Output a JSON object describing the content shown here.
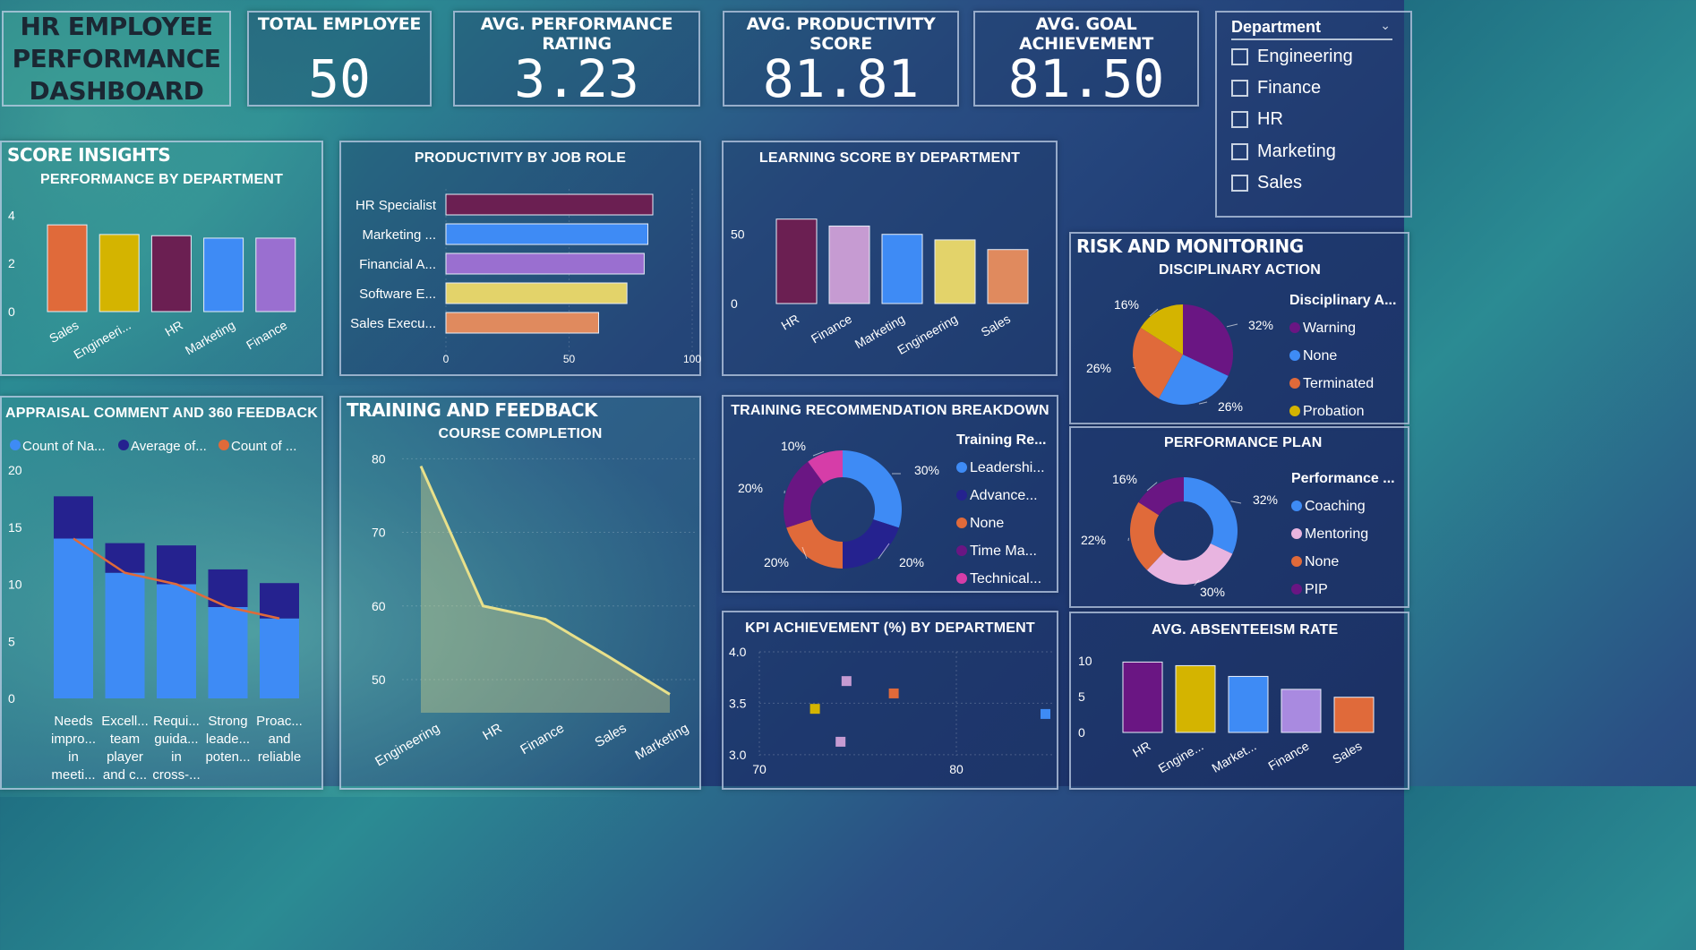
{
  "dashboard": {
    "title_lines": [
      "HR EMPLOYEE",
      "PERFORMANCE",
      "DASHBOARD"
    ]
  },
  "kpis": [
    {
      "label": "TOTAL EMPLOYEE",
      "value": "50"
    },
    {
      "label": "AVG. PERFORMANCE RATING",
      "value": "3.23"
    },
    {
      "label": "AVG. PRODUCTIVITY SCORE",
      "value": "81.81"
    },
    {
      "label": "AVG. GOAL ACHIEVEMENT",
      "value": "81.50"
    }
  ],
  "slicer": {
    "header": "Department",
    "items": [
      "Engineering",
      "Finance",
      "HR",
      "Marketing",
      "Sales"
    ]
  },
  "sections": {
    "score_insights": "SCORE INSIGHTS",
    "training_feedback": "TRAINING AND FEEDBACK",
    "risk_monitoring": "RISK AND MONITORING"
  },
  "colors": {
    "orange": "#e06a3a",
    "yellow": "#d4b400",
    "maroon": "#6b1f52",
    "blue": "#3e8bf5",
    "lavender": "#9a6fd0",
    "navy": "#25228f",
    "pink": "#c69bd2",
    "light_yellow": "#e3d36a",
    "salmon": "#e08a5e",
    "purple": "#6a1683",
    "magenta": "#d63da8",
    "pastel_pink": "#e8b4e0"
  },
  "chart_data": [
    {
      "id": "performance_by_department",
      "type": "bar",
      "title": "PERFORMANCE BY DEPARTMENT",
      "categories": [
        "Sales",
        "Engineeri...",
        "HR",
        "Marketing",
        "Finance"
      ],
      "values": [
        3.6,
        3.2,
        3.15,
        3.05,
        3.05
      ],
      "colors": [
        "#e06a3a",
        "#d4b400",
        "#6b1f52",
        "#3e8bf5",
        "#9a6fd0"
      ],
      "yticks": [
        0,
        2,
        4
      ],
      "ylim": [
        0,
        4.2
      ]
    },
    {
      "id": "productivity_by_job_role",
      "type": "bar",
      "orientation": "horizontal",
      "title": "PRODUCTIVITY BY JOB ROLE",
      "categories": [
        "HR Specialist",
        "Marketing ...",
        "Financial A...",
        "Software E...",
        "Sales Execu..."
      ],
      "values": [
        84,
        82,
        80.5,
        73.5,
        62
      ],
      "colors": [
        "#6b1f52",
        "#3e8bf5",
        "#9a6fd0",
        "#e3d36a",
        "#e08a5e"
      ],
      "xticks": [
        "0",
        "50",
        "100"
      ],
      "xlim": [
        0,
        100
      ]
    },
    {
      "id": "learning_score_by_department",
      "type": "bar",
      "title": "LEARNING SCORE BY DEPARTMENT",
      "categories": [
        "HR",
        "Finance",
        "Marketing",
        "Engineering",
        "Sales"
      ],
      "values": [
        61,
        56,
        50,
        46,
        39
      ],
      "colors": [
        "#6b1f52",
        "#c69bd2",
        "#3e8bf5",
        "#e3d36a",
        "#e08a5e"
      ],
      "yticks": [
        0,
        50
      ],
      "ylim": [
        0,
        66
      ]
    },
    {
      "id": "appraisal_comment_360_feedback",
      "type": "bar",
      "stacked": true,
      "title": "APPRAISAL COMMENT AND 360 FEEDBACK",
      "legend": [
        "Count of Na...",
        "Average of...",
        "Count of ..."
      ],
      "categories": [
        [
          "Needs",
          "impro...",
          "in",
          "meeti..."
        ],
        [
          "Excell...",
          "team",
          "player",
          "and c..."
        ],
        [
          "Requi...",
          "guida...",
          "in",
          "cross-..."
        ],
        [
          "Strong",
          "leade...",
          "poten..."
        ],
        [
          "Proac...",
          "and",
          "reliable"
        ]
      ],
      "series": [
        {
          "name": "Count of Na...",
          "values": [
            14,
            11,
            10,
            8,
            7
          ],
          "color": "#3e8bf5"
        },
        {
          "name": "Average of...",
          "values": [
            3.7,
            2.6,
            3.4,
            3.3,
            3.1
          ],
          "color": "#25228f"
        }
      ],
      "line": {
        "name": "Count of ...",
        "values": [
          14,
          11,
          10,
          8,
          7
        ],
        "color": "#e06a3a"
      },
      "yticks": [
        0,
        5,
        10,
        15,
        20
      ],
      "ylim": [
        0,
        20
      ]
    },
    {
      "id": "course_completion",
      "type": "area",
      "title": "COURSE COMPLETION",
      "categories": [
        "Engineering",
        "HR",
        "Finance",
        "Sales",
        "Marketing"
      ],
      "values": [
        79,
        60,
        58.2,
        53.2,
        48
      ],
      "yticks": [
        50,
        60,
        70,
        80
      ],
      "ylim": [
        45.5,
        81.5
      ],
      "color": "#e8e08a"
    },
    {
      "id": "training_recommendation_breakdown",
      "type": "pie",
      "donut": true,
      "title": "TRAINING RECOMMENDATION BREAKDOWN",
      "legend_title": "Training Re...",
      "labels": [
        "Leadershi...",
        "Advance...",
        "None",
        "Time Ma...",
        "Technical..."
      ],
      "values": [
        30,
        20,
        20,
        20,
        10
      ],
      "colors": [
        "#3e8bf5",
        "#25228f",
        "#e06a3a",
        "#6a1683",
        "#d63da8"
      ]
    },
    {
      "id": "kpi_achievement_by_department",
      "type": "scatter",
      "title": "KPI ACHIEVEMENT (%) BY DEPARTMENT",
      "points": [
        {
          "x": 74.4,
          "y": 3.72,
          "color": "#c69bd2"
        },
        {
          "x": 76.8,
          "y": 3.6,
          "color": "#e06a3a"
        },
        {
          "x": 72.8,
          "y": 3.45,
          "color": "#d4b400"
        },
        {
          "x": 74.1,
          "y": 3.13,
          "color": "#c69bd2"
        },
        {
          "x": 84.5,
          "y": 3.4,
          "color": "#3e8bf5"
        }
      ],
      "xticks": [
        70,
        80
      ],
      "yticks": [
        3.0,
        3.5,
        4.0
      ],
      "xlim": [
        70,
        85
      ],
      "ylim": [
        2.99,
        4.0
      ]
    },
    {
      "id": "disciplinary_action",
      "type": "pie",
      "title": "DISCIPLINARY ACTION",
      "legend_title": "Disciplinary A...",
      "labels": [
        "Warning",
        "None",
        "Terminated",
        "Probation"
      ],
      "values": [
        32,
        26,
        26,
        16
      ],
      "colors": [
        "#6a1683",
        "#3e8bf5",
        "#e06a3a",
        "#d4b400"
      ]
    },
    {
      "id": "performance_plan",
      "type": "pie",
      "donut": true,
      "title": "PERFORMANCE PLAN",
      "legend_title": "Performance ...",
      "labels": [
        "Coaching",
        "Mentoring",
        "None",
        "PIP"
      ],
      "values": [
        32,
        30,
        22,
        16
      ],
      "colors": [
        "#3e8bf5",
        "#e8b4e0",
        "#e06a3a",
        "#6a1683"
      ]
    },
    {
      "id": "avg_absenteeism_rate",
      "type": "bar",
      "title": "AVG. ABSENTEEISM RATE",
      "categories": [
        "HR",
        "Engine...",
        "Market...",
        "Finance",
        "Sales"
      ],
      "values": [
        9.8,
        9.3,
        7.8,
        6.0,
        4.9
      ],
      "colors": [
        "#6a1683",
        "#d4b400",
        "#3e8bf5",
        "#a98ae0",
        "#e06a3a"
      ],
      "yticks": [
        0,
        5,
        10
      ],
      "ylim": [
        0,
        10.6
      ]
    }
  ]
}
